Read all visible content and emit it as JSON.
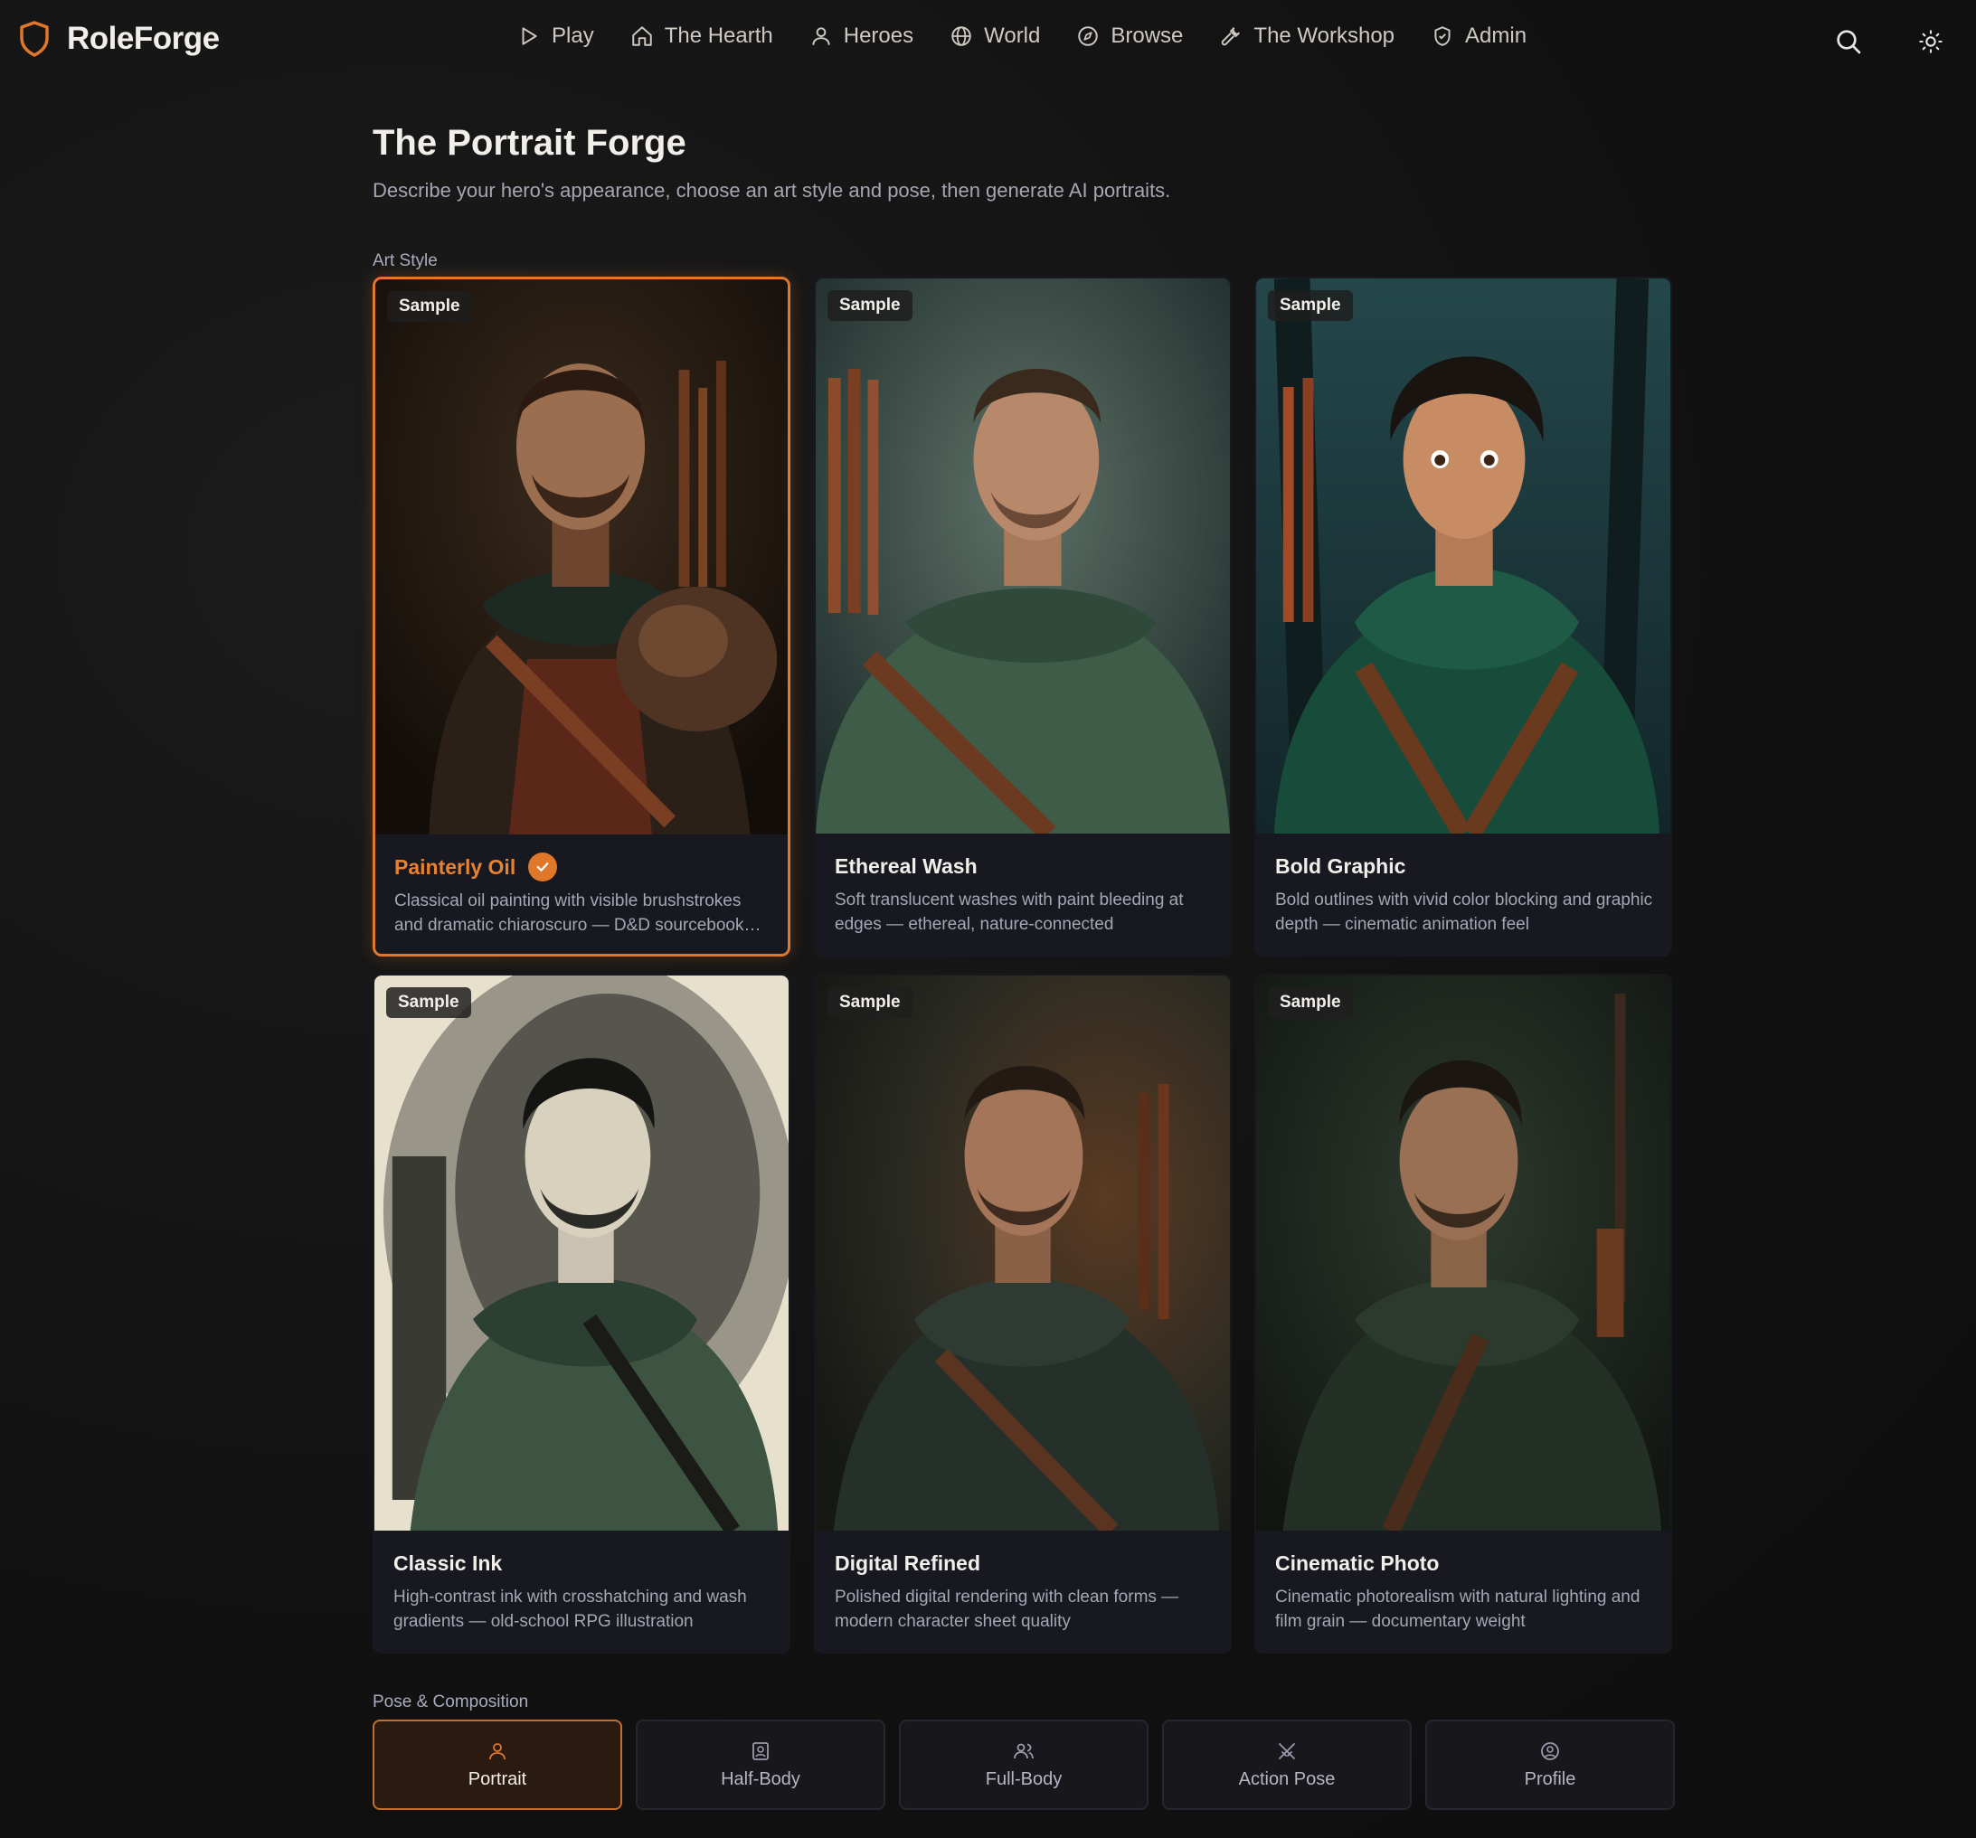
{
  "app": {
    "name": "RoleForge"
  },
  "nav": {
    "items": [
      {
        "label": "Play",
        "icon": "play-icon"
      },
      {
        "label": "The Hearth",
        "icon": "home-icon"
      },
      {
        "label": "Heroes",
        "icon": "user-icon"
      },
      {
        "label": "World",
        "icon": "globe-icon"
      },
      {
        "label": "Browse",
        "icon": "compass-icon"
      },
      {
        "label": "The Workshop",
        "icon": "wrench-icon"
      },
      {
        "label": "Admin",
        "icon": "shield-check-icon"
      }
    ]
  },
  "header": {
    "title": "The Portrait Forge",
    "subtitle": "Describe your hero's appearance, choose an art style and pose, then generate AI portraits."
  },
  "art_style": {
    "label": "Art Style",
    "badge": "Sample",
    "selected": "Painterly Oil",
    "styles": [
      {
        "title": "Painterly Oil",
        "desc": "Classical oil painting with visible brushstrokes and dramatic chiaroscuro — D&D sourcebook illustration"
      },
      {
        "title": "Ethereal Wash",
        "desc": "Soft translucent washes with paint bleeding at edges — ethereal, nature-connected"
      },
      {
        "title": "Bold Graphic",
        "desc": "Bold outlines with vivid color blocking and graphic depth — cinematic animation feel"
      },
      {
        "title": "Classic Ink",
        "desc": "High-contrast ink with crosshatching and wash gradients — old-school RPG illustration"
      },
      {
        "title": "Digital Refined",
        "desc": "Polished digital rendering with clean forms — modern character sheet quality"
      },
      {
        "title": "Cinematic Photo",
        "desc": "Cinematic photorealism with natural lighting and film grain — documentary weight"
      }
    ]
  },
  "pose": {
    "label": "Pose & Composition",
    "selected": "Portrait",
    "options": [
      {
        "label": "Portrait",
        "icon": "user-icon"
      },
      {
        "label": "Half-Body",
        "icon": "portrait-frame-icon"
      },
      {
        "label": "Full-Body",
        "icon": "users-icon"
      },
      {
        "label": "Action Pose",
        "icon": "crossed-swords-icon"
      },
      {
        "label": "Profile",
        "icon": "user-circle-icon"
      }
    ]
  },
  "colors": {
    "accent": "#e0782b",
    "background": "#131313",
    "card": "#181820"
  }
}
